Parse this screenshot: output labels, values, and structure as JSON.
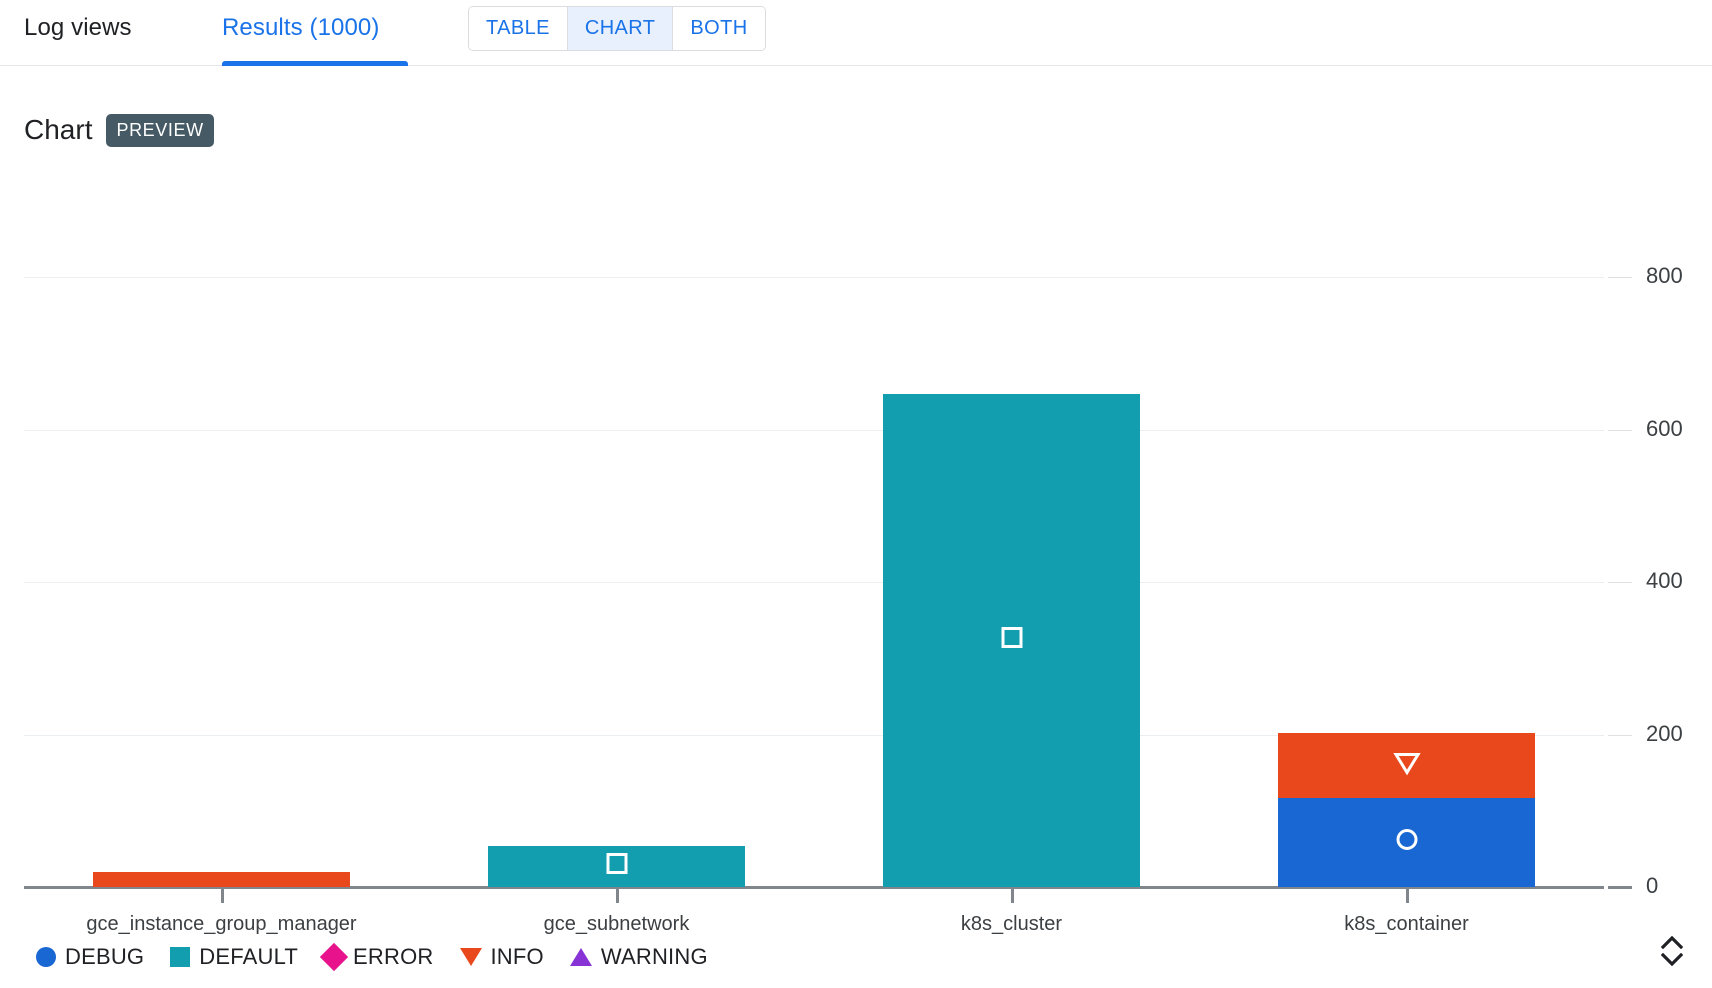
{
  "header": {
    "log_views_label": "Log views",
    "results_tab_label": "Results (1000)",
    "view_toggle": [
      {
        "label": "TABLE",
        "active": false
      },
      {
        "label": "CHART",
        "active": true
      },
      {
        "label": "BOTH",
        "active": false
      }
    ]
  },
  "chart_header": {
    "title": "Chart",
    "badge": "PREVIEW"
  },
  "controls": {
    "resize_handle": "expand-collapse-chevrons"
  },
  "colors": {
    "debug": "#1967d2",
    "default": "#129eae",
    "error": "#e8128c",
    "info": "#e8481c",
    "warning": "#8833d6",
    "accent": "#1a73e8",
    "badge_bg": "#455a64",
    "axis": "#80868b",
    "grid": "#eceff1"
  },
  "chart_data": {
    "type": "bar",
    "stacked": true,
    "title": "Chart",
    "xlabel": "",
    "ylabel": "",
    "ylim": [
      0,
      800
    ],
    "yticks": [
      0,
      200,
      400,
      600,
      800
    ],
    "grid": true,
    "legend_position": "bottom-left",
    "categories": [
      "gce_instance_group_manager",
      "gce_subnetwork",
      "k8s_cluster",
      "k8s_container"
    ],
    "series": [
      {
        "name": "DEBUG",
        "marker": "circle",
        "color": "#1967d2",
        "values": [
          0,
          0,
          0,
          117
        ]
      },
      {
        "name": "DEFAULT",
        "marker": "square",
        "color": "#129eae",
        "values": [
          0,
          54,
          647,
          0
        ]
      },
      {
        "name": "ERROR",
        "marker": "diamond",
        "color": "#e8128c",
        "values": [
          0,
          0,
          0,
          0
        ]
      },
      {
        "name": "INFO",
        "marker": "triangle-down",
        "color": "#e8481c",
        "values": [
          20,
          0,
          0,
          85
        ]
      },
      {
        "name": "WARNING",
        "marker": "triangle-up",
        "color": "#8833d6",
        "values": [
          0,
          0,
          0,
          0
        ]
      }
    ]
  }
}
